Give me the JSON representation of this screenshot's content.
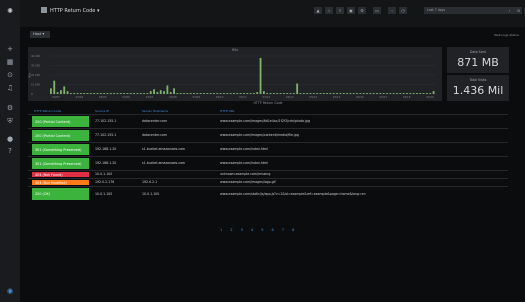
{
  "topbar": {
    "title": "HTTP Return Code",
    "time_range": "Last 7 days",
    "buttons": [
      "add-panel",
      "star",
      "share",
      "save",
      "settings",
      "view",
      "prev",
      "time",
      "next",
      "zoom",
      "refresh"
    ]
  },
  "variables": {
    "chip_label": "Host",
    "links": "Web Logs  Status"
  },
  "graph": {
    "title": "Hits"
  },
  "stats": [
    {
      "title": "Data Sent",
      "value": "871 MB"
    },
    {
      "title": "Total Visits",
      "value": "1.436 Mil"
    }
  ],
  "chart_data": {
    "type": "bar",
    "title": "Hits",
    "ylabel": "Hits",
    "yticks": [
      "40 000",
      "30 000",
      "20 000",
      "10 000",
      "0"
    ],
    "xticks": [
      "03/03",
      "03/04",
      "03/05",
      "03/06",
      "03/07",
      "03/08",
      "03/09",
      "03/10",
      "03/11",
      "03/12",
      "03/13",
      "03/14",
      "03/15",
      "03/16",
      "03/17",
      "03/18",
      "03/19"
    ],
    "ylim": [
      0,
      40000
    ],
    "values": [
      6000,
      14000,
      2000,
      4000,
      8000,
      3000,
      1000,
      1000,
      1000,
      1000,
      1000,
      1000,
      1000,
      1000,
      1000,
      1000,
      1000,
      1000,
      1000,
      1000,
      1000,
      1000,
      1000,
      1000,
      1000,
      1000,
      1000,
      1000,
      1000,
      1000,
      3000,
      5000,
      2000,
      4000,
      3000,
      9000,
      2000,
      6000,
      1000,
      1000,
      1000,
      1000,
      1000,
      1000,
      1000,
      1000,
      1000,
      1000,
      1000,
      1000,
      1000,
      1000,
      1000,
      1000,
      1000,
      1000,
      1000,
      1000,
      1000,
      1000,
      1000,
      1000,
      2000,
      38000,
      3000,
      1000,
      1000,
      1000,
      1000,
      1000,
      1000,
      1000,
      1000,
      1000,
      11000,
      1000,
      1000,
      1000,
      1000,
      1000,
      1000,
      1000,
      1000,
      1000,
      1000,
      1000,
      1000,
      1000,
      1000,
      1000,
      1000,
      1000,
      1000,
      1000,
      1000,
      1000,
      1000,
      1000,
      1000,
      1000,
      1000,
      1000,
      1000,
      1000,
      1000,
      1000,
      1000,
      1000,
      1000,
      1000,
      1000,
      1000,
      1000,
      1000,
      1000,
      3000
    ]
  },
  "table": {
    "title": "HTTP Return Code",
    "headers": [
      "HTTP Return Code",
      "Source IP",
      "Server Hostname",
      "HTTP URL"
    ],
    "rows": [
      {
        "status": "200 (Partial Content)",
        "color": "#3bb33d",
        "ip": "77.102.155.1",
        "host": "datacenter.com",
        "url": "www.example.com/images/6d1e4ac/1f2f3/cdn/photo.jpg"
      },
      {
        "status": "200 (Partial Content)",
        "color": "#3bb33d",
        "ip": "77.102.155.1",
        "host": "datacenter.com",
        "url": "www.example.com/images/content/media/file.jpg"
      },
      {
        "status": "301 (Something Preserved)",
        "color": "#3bb33d",
        "ip": "192.168.1.20",
        "host": "s1.bucket.amazonaws.com",
        "url": "www.example.com/index.html"
      },
      {
        "status": "301 (Something Preserved)",
        "color": "#3bb33d",
        "ip": "192.168.1.20",
        "host": "s1.bucket.amazonaws.com",
        "url": "www.example.com/index.html"
      },
      {
        "status": "404 (Not Found)",
        "color": "#e02f44",
        "ip": "10.0.1.100",
        "host": "",
        "url": "unknown.example.com/missing"
      },
      {
        "status": "304 (Not Modified)",
        "color": "#ff7a1a",
        "ip": "192.0.2.176",
        "host": "192.0.2.1",
        "url": "www.example.com/images/logo.gif"
      },
      {
        "status": "200 (OK)",
        "color": "#3bb33d",
        "ip": "10.0.1.100",
        "host": "10.0.1.100",
        "url": "www.example.com/static/js/app.js?v=1&id=example&ref=example&page=home&lang=en"
      }
    ]
  },
  "pager": [
    "1",
    "2",
    "3",
    "4",
    "5",
    "6",
    "7",
    "8"
  ]
}
